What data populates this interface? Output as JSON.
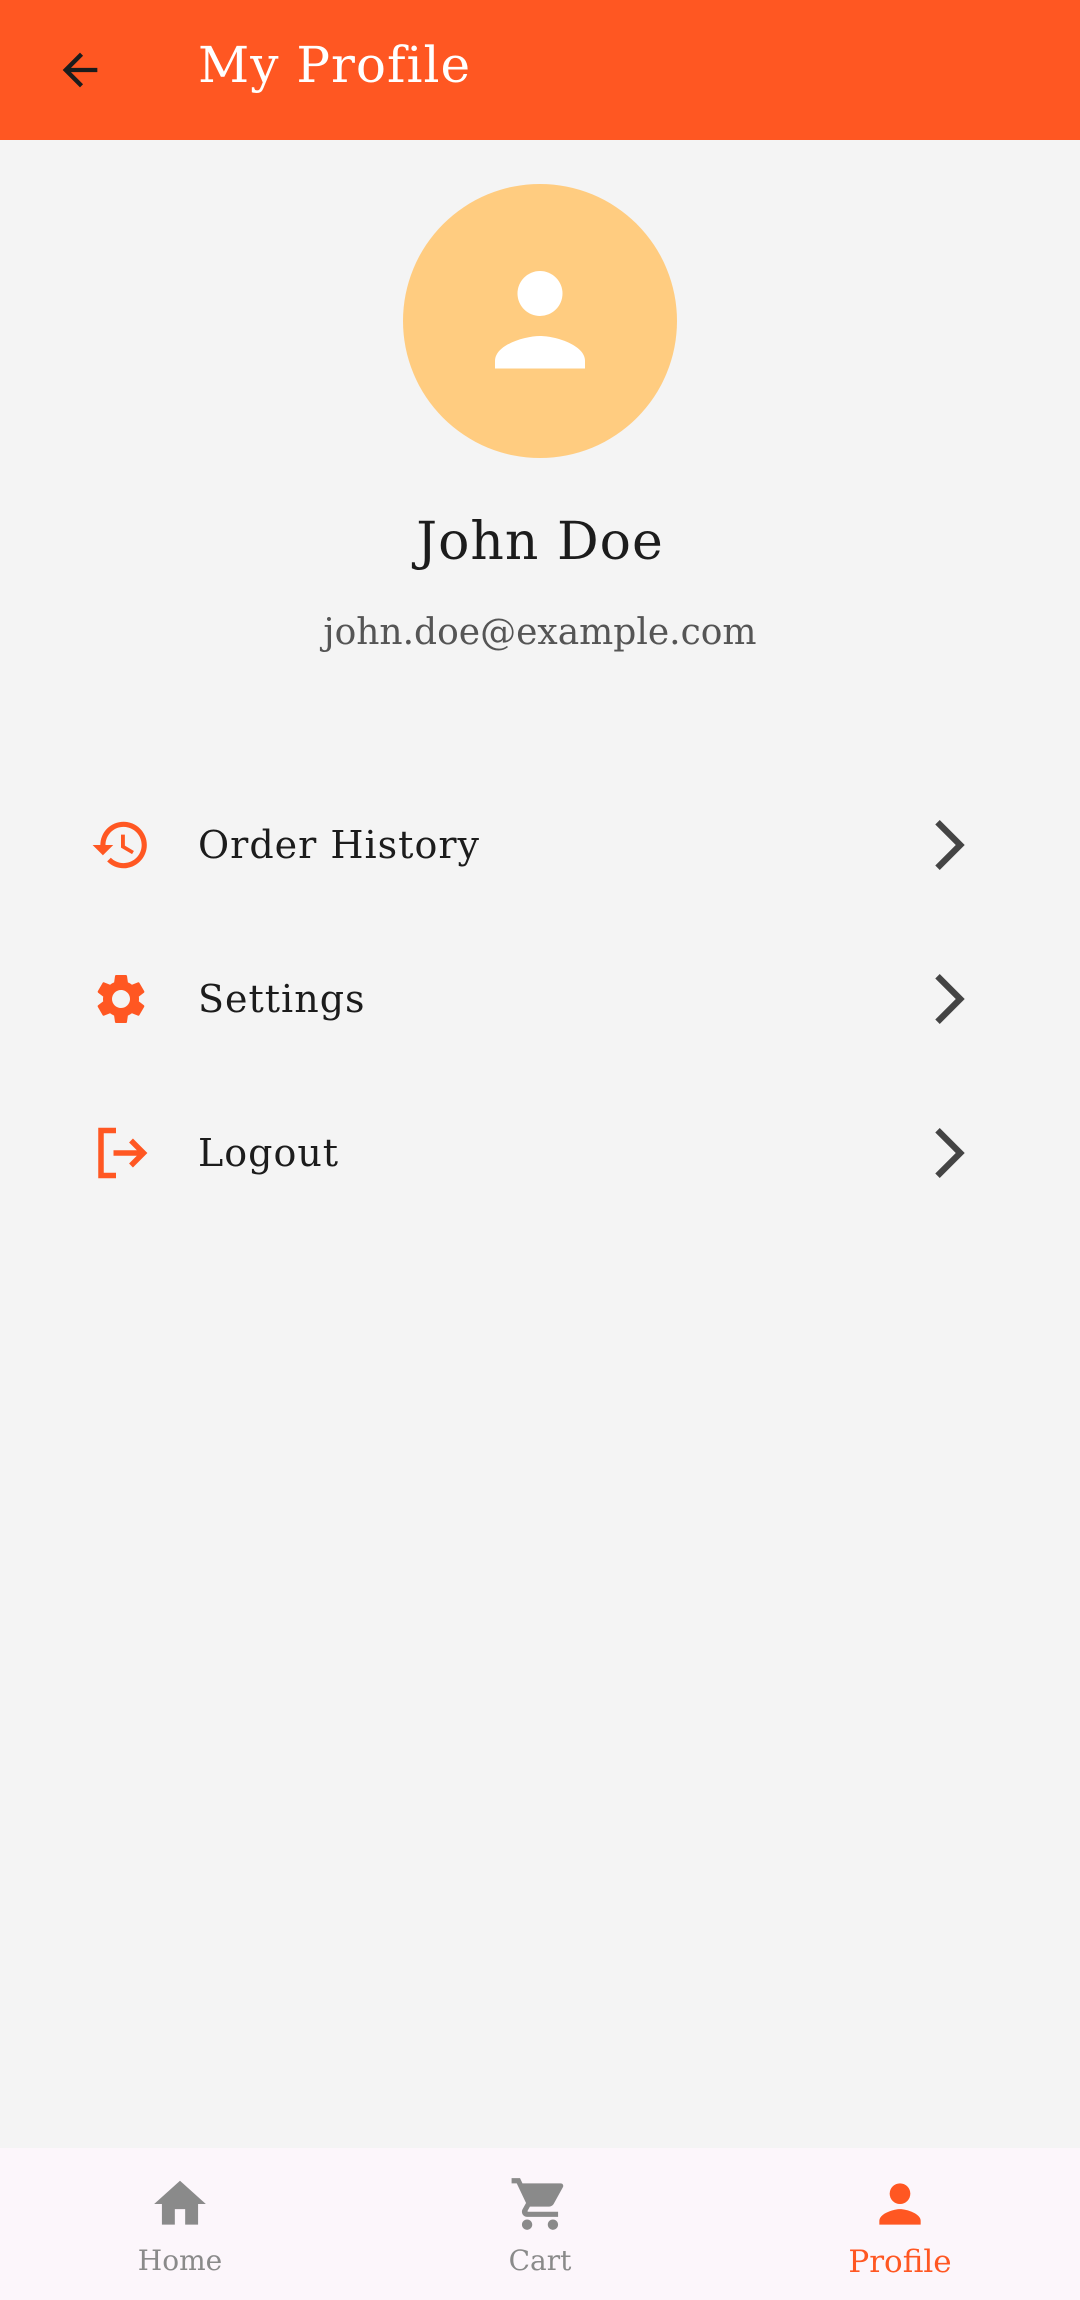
{
  "app_bar": {
    "title": "My Profile",
    "back_icon": "arrow-back-icon",
    "background": "#ff5722"
  },
  "profile": {
    "avatar_icon": "person-icon",
    "avatar_color": "#ffcc80",
    "name": "John Doe",
    "email": "john.doe@example.com"
  },
  "menu": {
    "items": [
      {
        "label": "Order History",
        "icon": "history-icon"
      },
      {
        "label": "Settings",
        "icon": "gear-icon"
      },
      {
        "label": "Logout",
        "icon": "logout-icon"
      }
    ],
    "accent": "#ff5722"
  },
  "bottom_nav": {
    "items": [
      {
        "label": "Home",
        "icon": "home-icon"
      },
      {
        "label": "Cart",
        "icon": "cart-icon"
      },
      {
        "label": "Profile",
        "icon": "person-icon"
      }
    ],
    "active": "Profile",
    "active_color": "#ff5722",
    "inactive_color": "#8a8a8a"
  }
}
